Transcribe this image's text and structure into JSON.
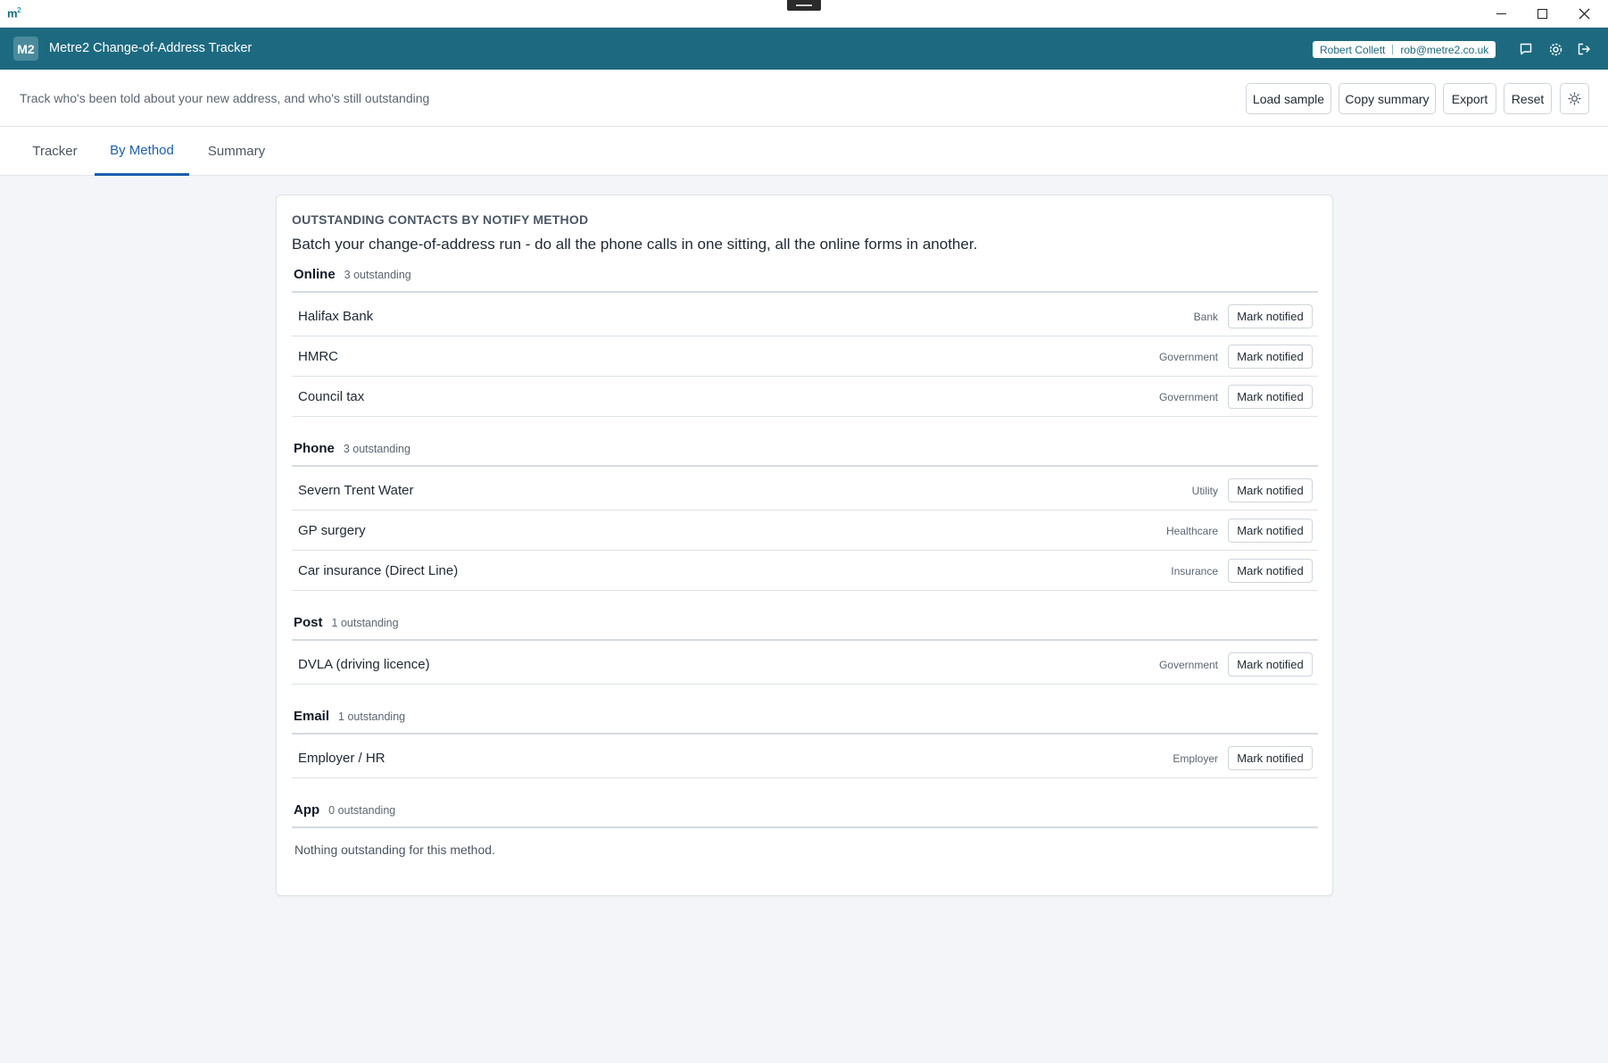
{
  "os": {
    "logo_main": "m",
    "logo_sup": "2"
  },
  "header": {
    "logo_text": "M2",
    "title": "Metre2 Change-of-Address Tracker",
    "user_name": "Robert Collett",
    "user_email": "rob@metre2.co.uk"
  },
  "toolbar": {
    "subtitle": "Track who's been told about your new address, and who's still outstanding",
    "load_label": "Load sample",
    "copy_label": "Copy summary",
    "export_label": "Export",
    "reset_label": "Reset"
  },
  "tabs": {
    "tracker": "Tracker",
    "by_method": "By Method",
    "summary": "Summary",
    "active": "By Method"
  },
  "card": {
    "kicker": "OUTSTANDING CONTACTS BY NOTIFY METHOD",
    "lead": "Batch your change-of-address run - do all the phone calls in one sitting, all the online forms in another.",
    "mark_label": "Mark notified",
    "empty_text": "Nothing outstanding for this method."
  },
  "groups": [
    {
      "name": "Online",
      "count": "3 outstanding",
      "rows": [
        {
          "name": "Halifax Bank",
          "category": "Bank"
        },
        {
          "name": "HMRC",
          "category": "Government"
        },
        {
          "name": "Council tax",
          "category": "Government"
        }
      ]
    },
    {
      "name": "Phone",
      "count": "3 outstanding",
      "rows": [
        {
          "name": "Severn Trent Water",
          "category": "Utility"
        },
        {
          "name": "GP surgery",
          "category": "Healthcare"
        },
        {
          "name": "Car insurance (Direct Line)",
          "category": "Insurance"
        }
      ]
    },
    {
      "name": "Post",
      "count": "1 outstanding",
      "rows": [
        {
          "name": "DVLA (driving licence)",
          "category": "Government"
        }
      ]
    },
    {
      "name": "Email",
      "count": "1 outstanding",
      "rows": [
        {
          "name": "Employer / HR",
          "category": "Employer"
        }
      ]
    },
    {
      "name": "App",
      "count": "0 outstanding",
      "rows": []
    }
  ],
  "colors": {
    "header_bg": "#1d6a80",
    "accent": "#1b5fae",
    "page_bg": "#f3f5f8"
  },
  "icons": [
    "chat-icon",
    "gear-icon",
    "logout-icon",
    "sun-icon",
    "minimize-icon",
    "maximize-icon",
    "close-icon"
  ]
}
